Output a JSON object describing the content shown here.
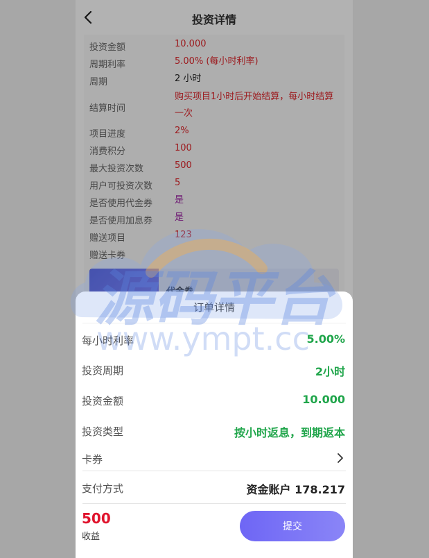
{
  "header": {
    "title": "投资详情"
  },
  "details": [
    {
      "key": "投资金额",
      "value": "10.000",
      "style": "red"
    },
    {
      "key": "周期利率",
      "value": "5.00% (每小时利率)",
      "style": "red"
    },
    {
      "key": "周期",
      "value": "2 小时",
      "style": "dark"
    },
    {
      "key": "结算时间",
      "value": "购买项目1小时后开始结算，每小时结算一次",
      "style": "red"
    },
    {
      "key": "项目进度",
      "value": "2%",
      "style": "red"
    },
    {
      "key": "消费积分",
      "value": "100",
      "style": "red"
    },
    {
      "key": "最大投资次数",
      "value": "500",
      "style": "red"
    },
    {
      "key": "用户可投资次数",
      "value": "5",
      "style": "red"
    },
    {
      "key": "是否使用代金券",
      "value": "是",
      "style": "violet"
    },
    {
      "key": "是否使用加息券",
      "value": "是",
      "style": "violet"
    },
    {
      "key": "赠送项目",
      "value": "123",
      "style": "red"
    },
    {
      "key": "赠送卡券",
      "value": "",
      "style": "red"
    }
  ],
  "voucher": {
    "name": "代金券"
  },
  "watermark": {
    "text": "源码平台",
    "url": "www.ympt.cc"
  },
  "sheet": {
    "title": "订单详情",
    "hourly_rate": {
      "label": "每小时利率",
      "value": "5.00%"
    },
    "period": {
      "label": "投资周期",
      "value": "2小时"
    },
    "amount": {
      "label": "投资金额",
      "value": "10.000"
    },
    "type": {
      "label": "投资类型",
      "value": "按小时返息，到期返本"
    },
    "coupon": {
      "label": "卡券"
    },
    "payment": {
      "label": "支付方式",
      "value": "资金账户 178.217"
    },
    "earnings": {
      "value": "500",
      "label": "收益"
    },
    "submit_label": "提交"
  },
  "colors": {
    "accent": "#6e66f5",
    "green": "#1fa54a",
    "red": "#e0142d"
  },
  "icons": {
    "back": "chevron-left-icon",
    "coupon": "chevron-right-icon"
  }
}
